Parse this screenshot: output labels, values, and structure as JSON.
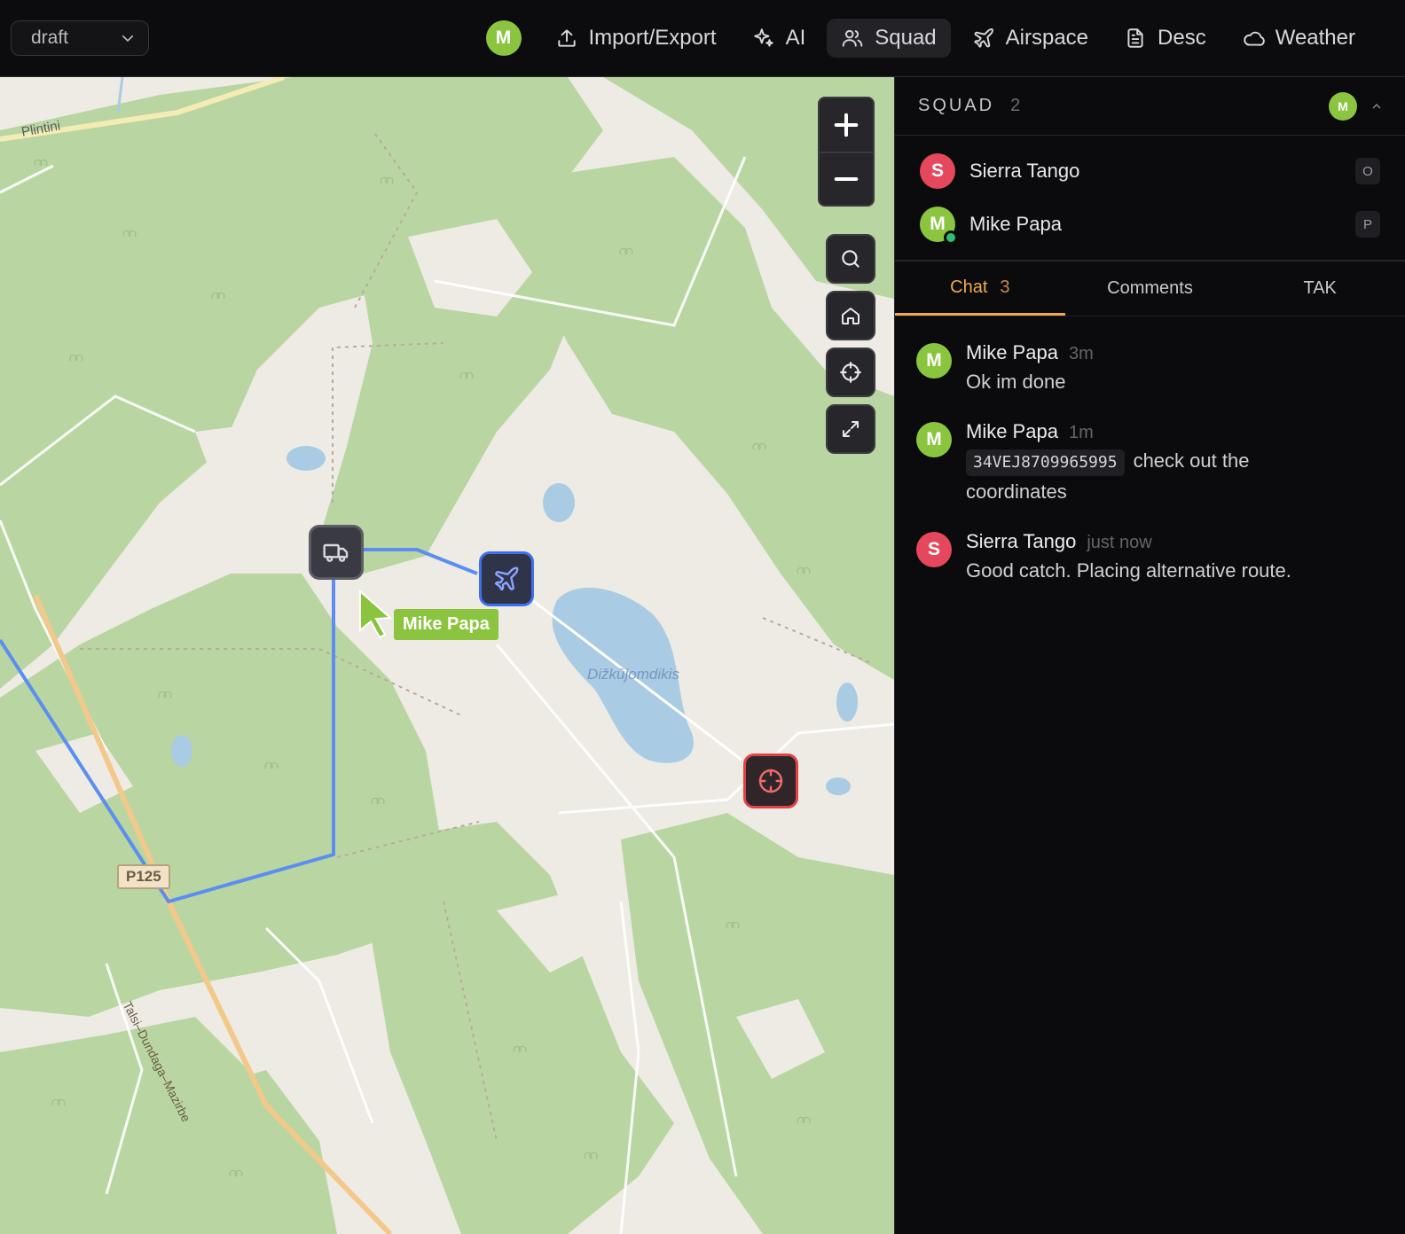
{
  "topbar": {
    "mission_select": "draft",
    "user_initial": "M",
    "nav": [
      {
        "label": "Import/Export",
        "icon": "upload-icon"
      },
      {
        "label": "AI",
        "icon": "sparkles-icon"
      },
      {
        "label": "Squad",
        "icon": "users-icon",
        "active": true
      },
      {
        "label": "Airspace",
        "icon": "plane-icon"
      },
      {
        "label": "Desc",
        "icon": "document-icon"
      },
      {
        "label": "Weather",
        "icon": "cloud-icon"
      }
    ]
  },
  "map": {
    "labels": {
      "place_top": "Plintini",
      "lake": "Dižkūjomdikis",
      "road_shield": "P125",
      "road_name": "Talsi–Dundaga–Mazirbe"
    },
    "cursor_user": "Mike Papa",
    "markers": [
      {
        "type": "truck",
        "icon": "truck-icon"
      },
      {
        "type": "plane",
        "icon": "plane-icon"
      },
      {
        "type": "target",
        "icon": "crosshair-icon"
      }
    ],
    "colors": {
      "route": "#5b8ef0",
      "forest": "#b9d6a2",
      "land": "#eeebe5",
      "water": "#a9cbe3",
      "target": "#e04343"
    }
  },
  "squad": {
    "title": "SQUAD",
    "count": "2",
    "self_initial": "M",
    "members": [
      {
        "initial": "S",
        "name": "Sierra Tango",
        "role": "O",
        "color": "#e5485c",
        "online": false
      },
      {
        "initial": "M",
        "name": "Mike Papa",
        "role": "P",
        "color": "#8bc53f",
        "online": true
      }
    ]
  },
  "tabs": [
    {
      "label": "Chat",
      "count": "3",
      "active": true
    },
    {
      "label": "Comments",
      "count": ""
    },
    {
      "label": "TAK",
      "count": ""
    }
  ],
  "chat": [
    {
      "initial": "M",
      "author": "Mike Papa",
      "time": "3m",
      "code": "",
      "text": "Ok im done"
    },
    {
      "initial": "M",
      "author": "Mike Papa",
      "time": "1m",
      "code": "34VEJ8709965995",
      "text": "check out the coordinates"
    },
    {
      "initial": "S",
      "author": "Sierra Tango",
      "time": "just now",
      "code": "",
      "text": "Good catch. Placing alternative route."
    }
  ]
}
